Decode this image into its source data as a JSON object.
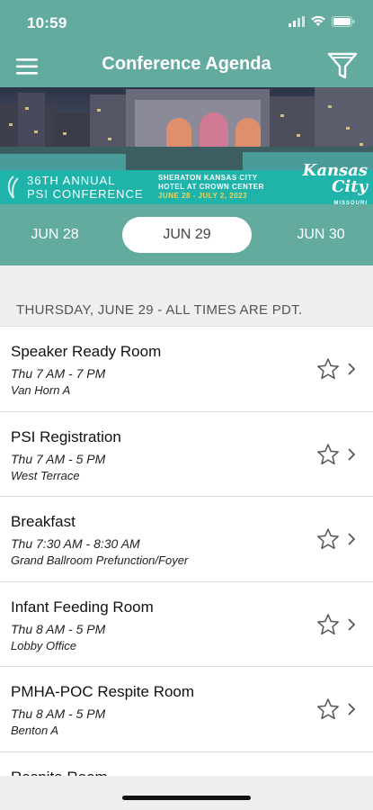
{
  "status": {
    "time": "10:59"
  },
  "app": {
    "title": "Conference Agenda"
  },
  "banner": {
    "line1": "36TH ANNUAL",
    "line2": "PSI CONFERENCE",
    "venue_line1": "SHERATON KANSAS CITY",
    "venue_line2": "HOTEL AT CROWN CENTER",
    "dates": "JUNE 28 - JULY 2, 2023",
    "city": "Kansas City",
    "city_sub": "MISSOURI"
  },
  "dates": [
    {
      "label": "JUN 28",
      "selected": false
    },
    {
      "label": "JUN 29",
      "selected": true
    },
    {
      "label": "JUN 30",
      "selected": false
    }
  ],
  "day_heading": "THURSDAY, JUNE 29 - ALL TIMES ARE PDT.",
  "sessions": [
    {
      "title": "Speaker Ready Room",
      "time": "Thu 7 AM - 7 PM",
      "location": "Van Horn A"
    },
    {
      "title": "PSI Registration",
      "time": "Thu 7 AM - 5 PM",
      "location": "West Terrace"
    },
    {
      "title": "Breakfast",
      "time": "Thu 7:30 AM - 8:30 AM",
      "location": "Grand Ballroom Prefunction/Foyer"
    },
    {
      "title": "Infant Feeding Room",
      "time": "Thu 8 AM - 5 PM",
      "location": "Lobby Office"
    },
    {
      "title": "PMHA-POC Respite Room",
      "time": "Thu 8 AM - 5 PM",
      "location": "Benton A"
    },
    {
      "title": "Respite Room",
      "time": "",
      "location": ""
    }
  ],
  "colors": {
    "header": "#62ab9e",
    "banner_strip": "#1fb3a9",
    "background": "#efefef"
  },
  "icons": [
    "hamburger-menu-icon",
    "filter-funnel-icon",
    "star-icon",
    "chevron-right-icon",
    "signal-icon",
    "wifi-icon",
    "battery-icon"
  ]
}
